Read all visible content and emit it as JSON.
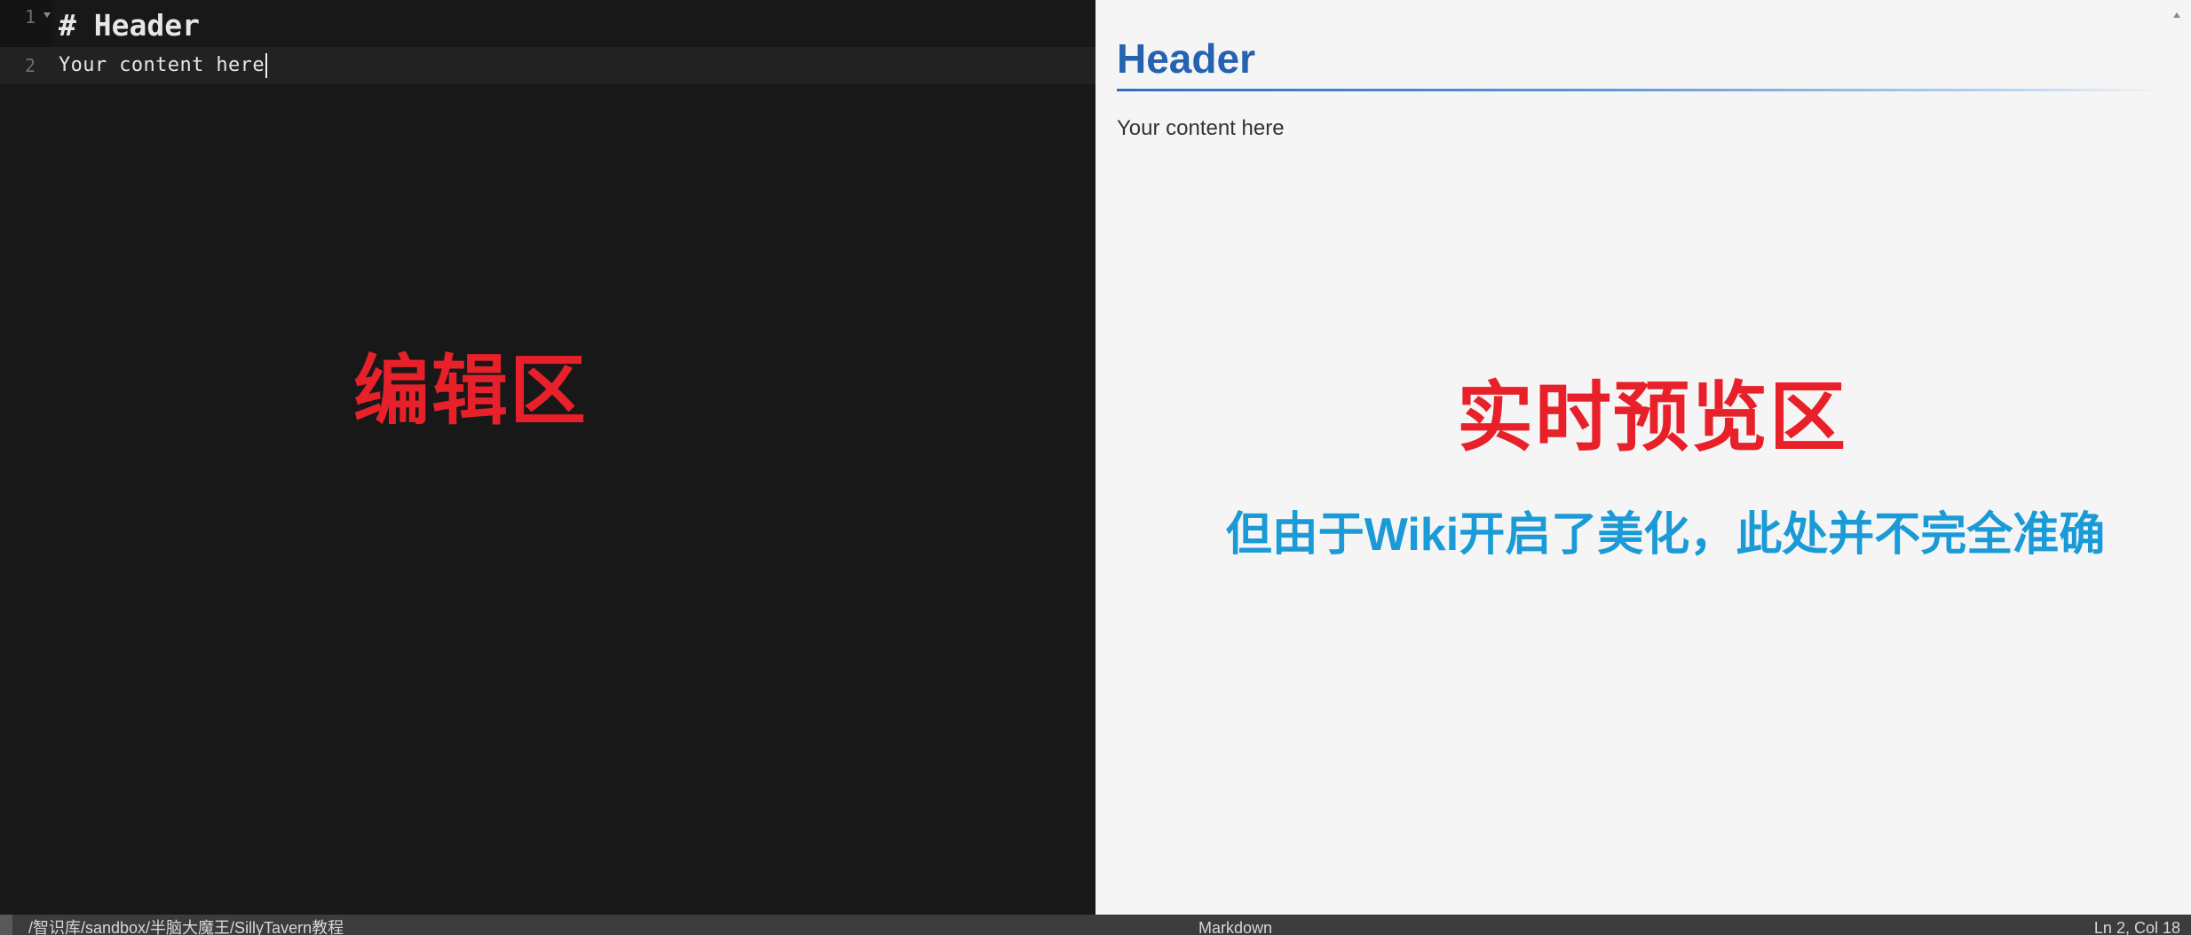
{
  "editor": {
    "lines": [
      {
        "number": "1",
        "text": "# Header"
      },
      {
        "number": "2",
        "text": "Your content here"
      }
    ],
    "annotation": "编辑区"
  },
  "preview": {
    "heading": "Header",
    "paragraph": "Your content here",
    "annotation_main": "实时预览区",
    "annotation_sub": "但由于Wiki开启了美化，此处并不完全准确"
  },
  "statusbar": {
    "path": "/智识库/sandbox/半脑大魔王/SillyTavern教程",
    "mode": "Markdown",
    "cursor_position": "Ln 2, Col 18"
  },
  "colors": {
    "editor_bg": "#181818",
    "preview_bg": "#f5f5f5",
    "heading_blue": "#2563b0",
    "annotation_red": "#e8202a",
    "annotation_blue": "#1a9ad6",
    "statusbar_bg": "#3c3c3c"
  }
}
